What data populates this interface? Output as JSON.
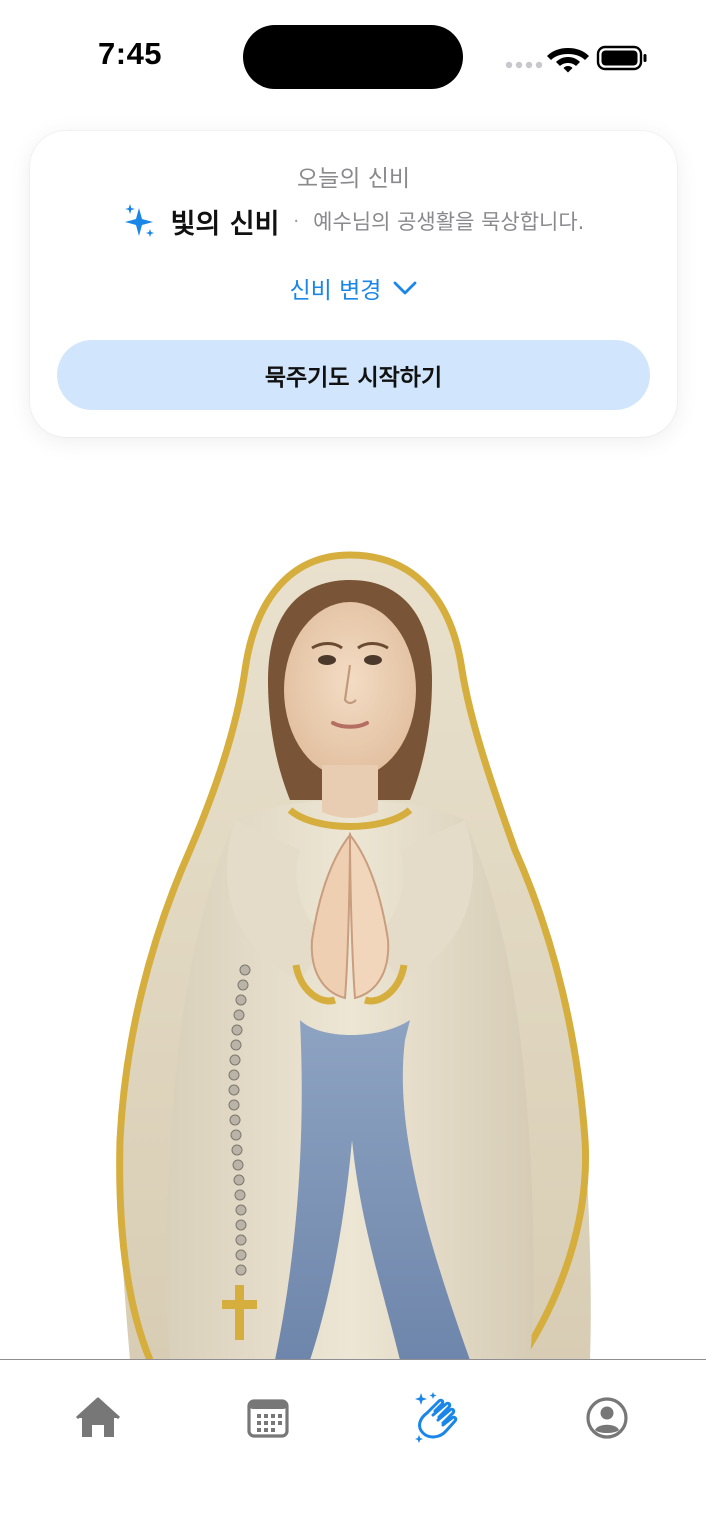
{
  "status_bar": {
    "time": "7:45",
    "icons": [
      "cellular-icon",
      "wifi-icon",
      "battery-icon"
    ]
  },
  "mystery_card": {
    "heading": "오늘의 신비",
    "mystery_icon": "sparkle-icon",
    "mystery_name": "빛의 신비",
    "separator": "·",
    "mystery_description": "예수님의 공생활을 묵상합니다.",
    "change_label": "신비 변경",
    "change_icon": "chevron-down-icon",
    "start_button_label": "묵주기도 시작하기"
  },
  "illustration": {
    "subject": "praying-virgin-mary"
  },
  "tab_bar": {
    "tabs": [
      {
        "icon": "house-icon",
        "active": false
      },
      {
        "icon": "calendar-icon",
        "active": false
      },
      {
        "icon": "praying-hands-sparkle-icon",
        "active": true
      },
      {
        "icon": "person-circle-icon",
        "active": false
      }
    ]
  },
  "colors": {
    "accent": "#1a86e8",
    "button_background": "#d1e6fc",
    "inactive_tab": "#777777",
    "secondary_text": "#8a8a8e"
  }
}
